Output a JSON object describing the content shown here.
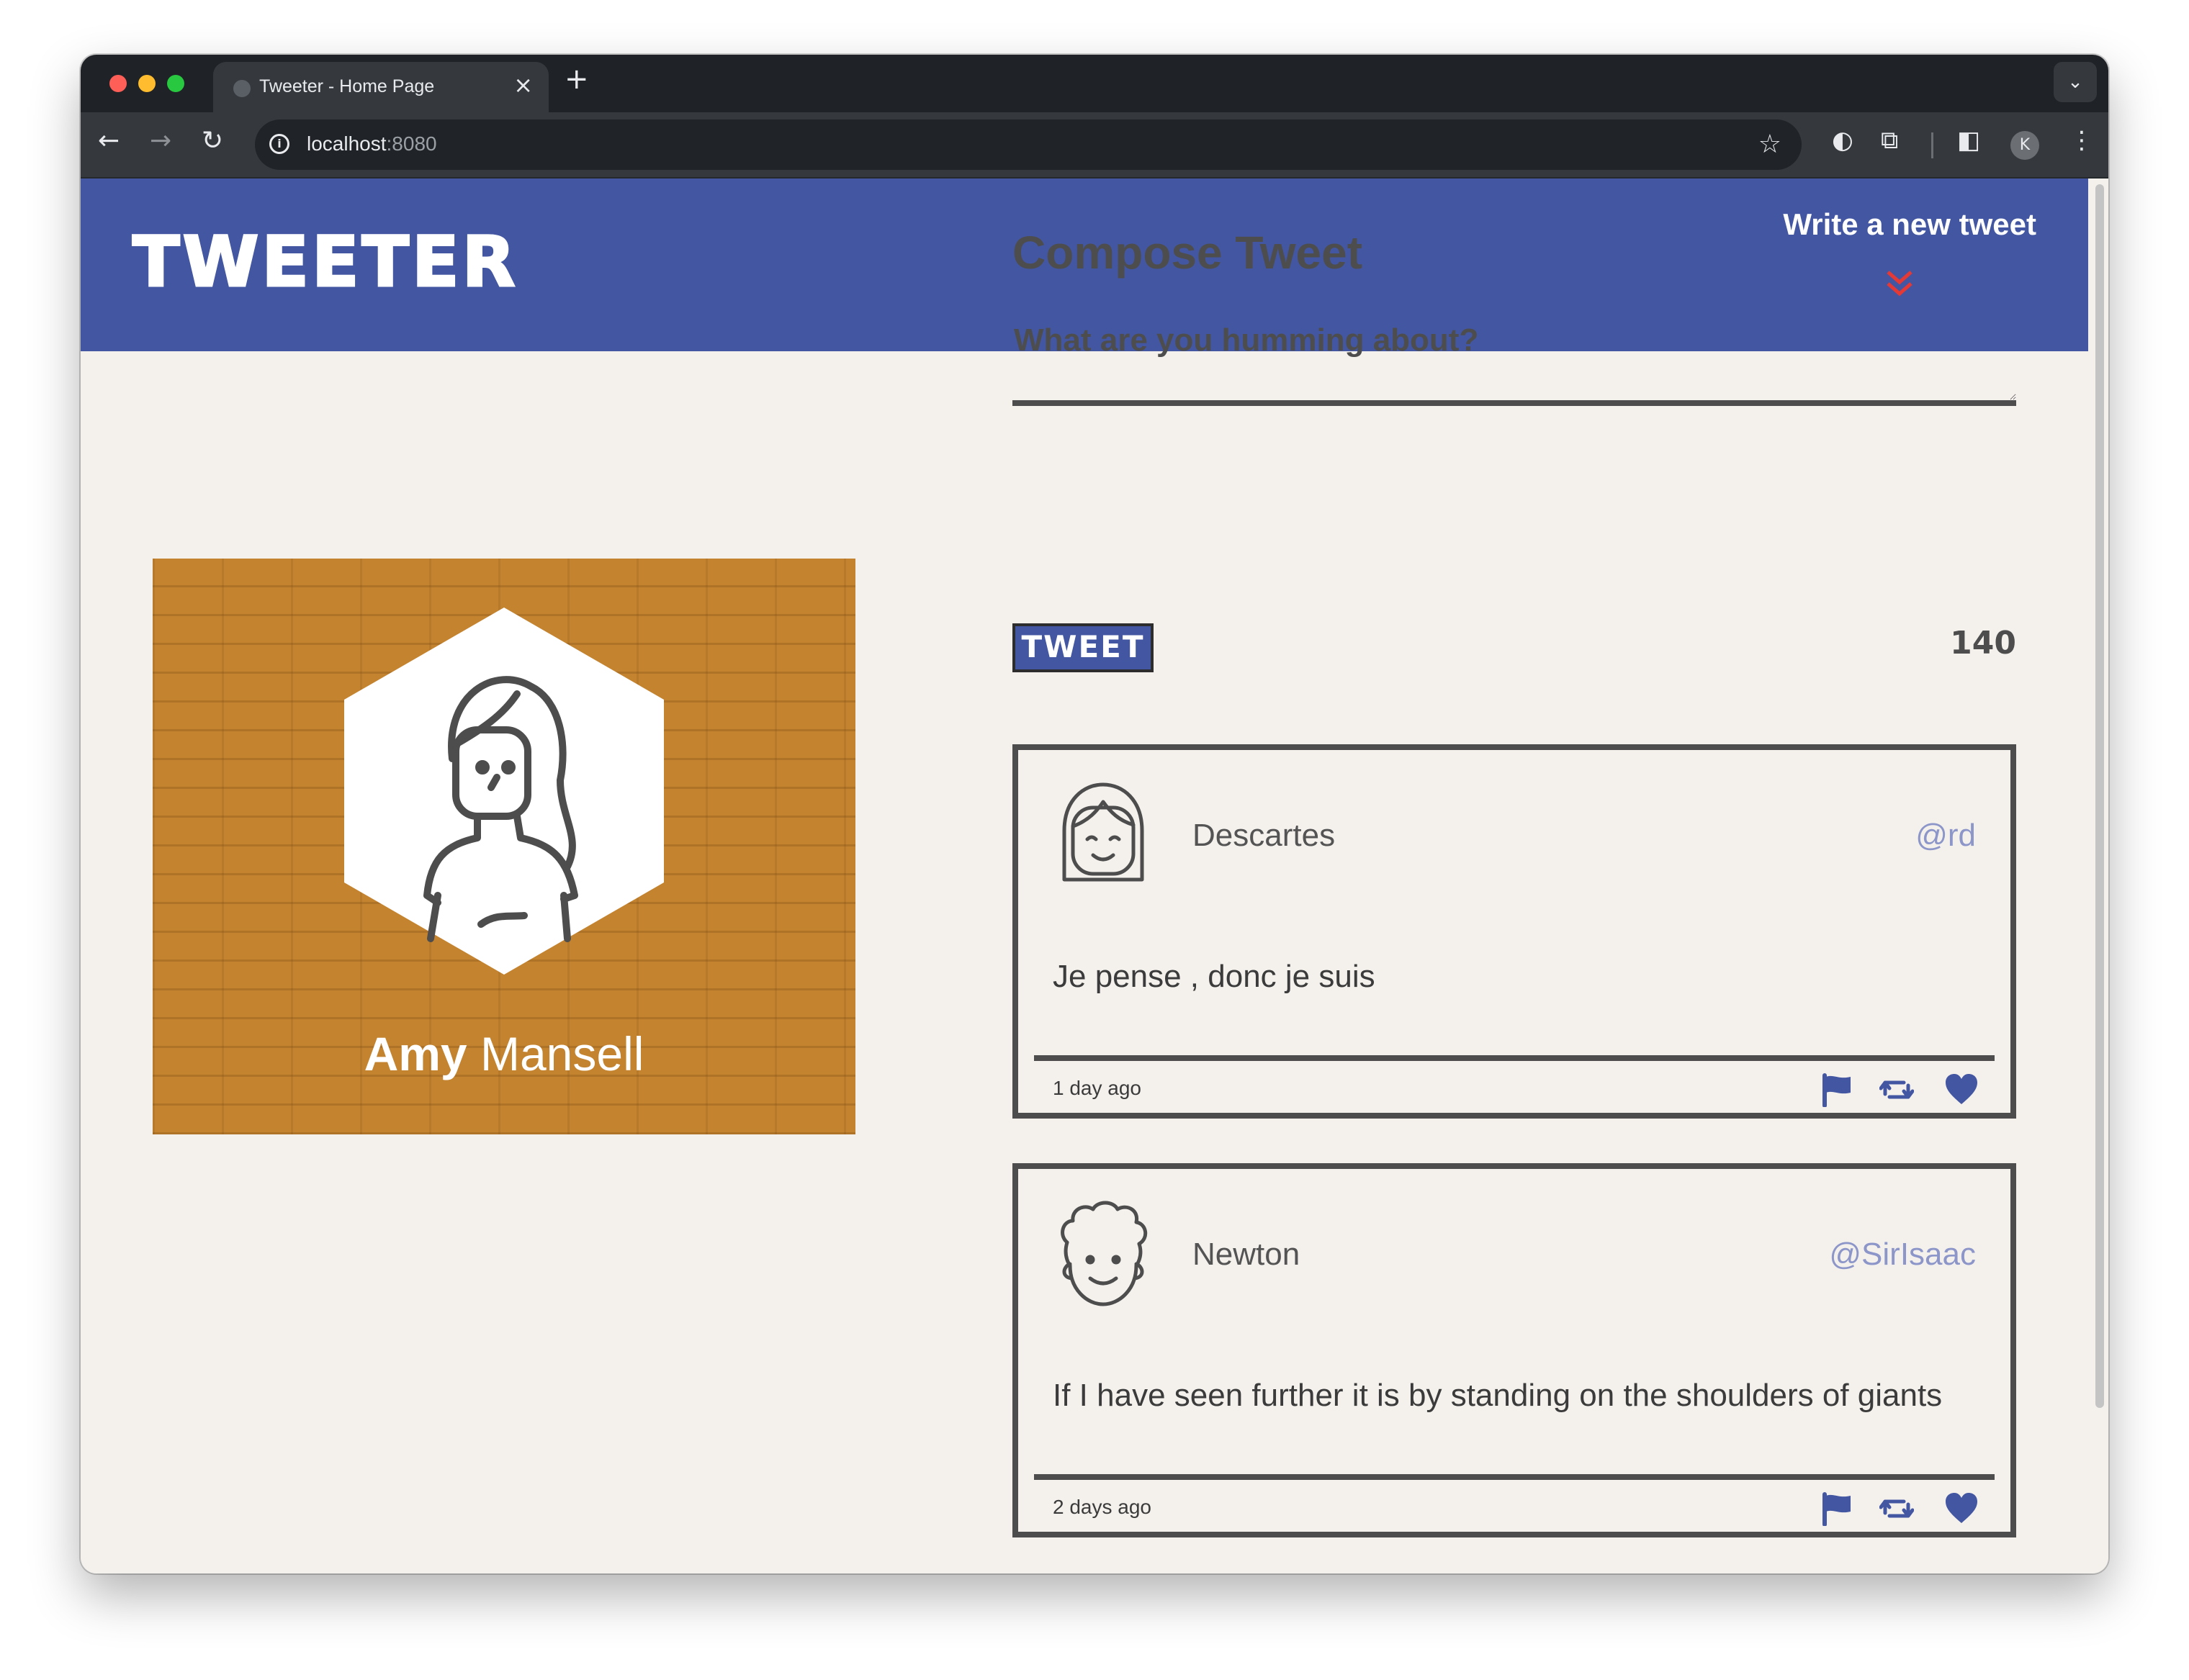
{
  "browser": {
    "tab_title": "Tweeter - Home Page",
    "url_host": "localhost",
    "url_port": ":8080",
    "profile_initial": "K"
  },
  "header": {
    "logo": "TWEETER",
    "write_new_tweet": "Write a new tweet"
  },
  "profile": {
    "first_name": "Amy",
    "last_name": "Mansell"
  },
  "compose": {
    "title": "Compose Tweet",
    "prompt": "What are you humming about?",
    "button_label": "TWEET",
    "counter": "140"
  },
  "tweets": [
    {
      "name": "Descartes",
      "handle": "@rd",
      "content": "Je pense , donc je suis",
      "time": "1 day ago"
    },
    {
      "name": "Newton",
      "handle": "@SirIsaac",
      "content": "If I have seen further it is by standing on the shoulders of giants",
      "time": "2 days ago"
    }
  ],
  "colors": {
    "header_blue": "#4356a1",
    "page_bg": "#f4f1ed",
    "text_dark": "#4d4d4d",
    "handle": "#8d96c9",
    "accent_red": "#e53935",
    "profile_bg": "#c4832f"
  }
}
